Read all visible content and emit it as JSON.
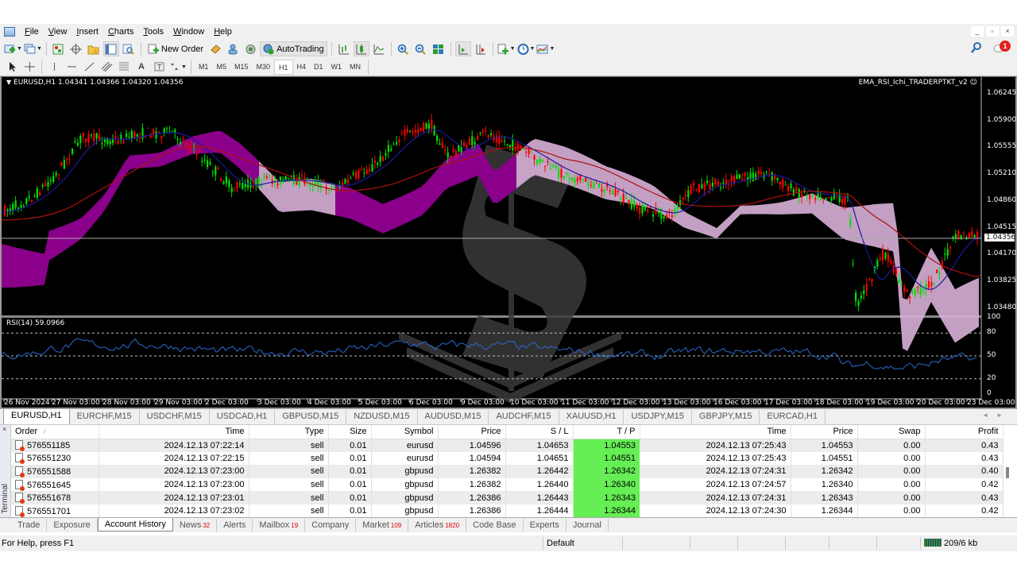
{
  "menu": {
    "items": [
      {
        "label": "File",
        "accel": "F"
      },
      {
        "label": "View",
        "accel": "V"
      },
      {
        "label": "Insert",
        "accel": "I"
      },
      {
        "label": "Charts",
        "accel": "C"
      },
      {
        "label": "Tools",
        "accel": "T"
      },
      {
        "label": "Window",
        "accel": "W"
      },
      {
        "label": "Help",
        "accel": "H"
      }
    ],
    "window_buttons": [
      "_",
      "▫",
      "×"
    ]
  },
  "toolbar": {
    "new_order_label": "New Order",
    "autotrading_label": "AutoTrading",
    "notification_count": "1"
  },
  "timeframes": [
    "M1",
    "M5",
    "M15",
    "M30",
    "H1",
    "H4",
    "D1",
    "W1",
    "MN"
  ],
  "active_timeframe": "H1",
  "chart": {
    "header": "EURUSD,H1  1.04341 1.04366 1.04320 1.04356",
    "symbol": "EURUSD,H1",
    "ohlc": {
      "open": "1.04341",
      "high": "1.04366",
      "low": "1.04320",
      "close": "1.04356"
    },
    "expert_label": "EMA_RSI_Ichi_TRADERPTKT_v2 ☺",
    "current_price": "1.04356",
    "price_ticks": [
      "1.06245",
      "1.05900",
      "1.05555",
      "1.05210",
      "1.04860",
      "1.04515",
      "1.04170",
      "1.03825",
      "1.03480"
    ],
    "rsi_label": "RSI(14) 59.0966",
    "rsi_ticks": [
      "100",
      "80",
      "50",
      "20",
      "0"
    ],
    "time_ticks": [
      "26 Nov 2024",
      "27 Nov 03:00",
      "28 Nov 03:00",
      "29 Nov 03:00",
      "2 Dec 03:00",
      "3 Dec 03:00",
      "4 Dec 03:00",
      "5 Dec 03:00",
      "6 Dec 03:00",
      "9 Dec 03:00",
      "10 Dec 03:00",
      "11 Dec 03:00",
      "12 Dec 03:00",
      "13 Dec 03:00",
      "16 Dec 03:00",
      "17 Dec 03:00",
      "18 Dec 03:00",
      "19 Dec 03:00",
      "20 Dec 03:00",
      "23 Dec 03:00"
    ],
    "colors": {
      "bull": "#00e000",
      "bear": "#ff0000",
      "cloud_bull": "#8b008b",
      "cloud_bear": "#d8b0d8",
      "ema_fast": "#1a1aa0",
      "ema_slow": "#b01010",
      "rsi": "#2a6ad0"
    }
  },
  "chart_tabs": [
    "EURUSD,H1",
    "EURCHF,M15",
    "USDCHF,M15",
    "USDCAD,H1",
    "GBPUSD,M15",
    "NZDUSD,M15",
    "AUDUSD,M15",
    "AUDCHF,M15",
    "XAUUSD,H1",
    "USDJPY,M15",
    "GBPJPY,M15",
    "EURCAD,H1"
  ],
  "active_chart_tab": "EURUSD,H1",
  "history": {
    "columns": [
      "Order",
      "Time",
      "Type",
      "Size",
      "Symbol",
      "Price",
      "S / L",
      "T / P",
      "Time",
      "Price",
      "Swap",
      "Profit"
    ],
    "sort_indicator": "/",
    "rows": [
      [
        "576551185",
        "2024.12.13 07:22:14",
        "sell",
        "0.01",
        "eurusd",
        "1.04596",
        "1.04653",
        "1.04553",
        "2024.12.13 07:25:43",
        "1.04553",
        "0.00",
        "0.43"
      ],
      [
        "576551230",
        "2024.12.13 07:22:15",
        "sell",
        "0.01",
        "eurusd",
        "1.04594",
        "1.04651",
        "1.04551",
        "2024.12.13 07:25:43",
        "1.04551",
        "0.00",
        "0.43"
      ],
      [
        "576551588",
        "2024.12.13 07:23:00",
        "sell",
        "0.01",
        "gbpusd",
        "1.26382",
        "1.26442",
        "1.26342",
        "2024.12.13 07:24:31",
        "1.26342",
        "0.00",
        "0.40"
      ],
      [
        "576551645",
        "2024.12.13 07:23:00",
        "sell",
        "0.01",
        "gbpusd",
        "1.26382",
        "1.26440",
        "1.26340",
        "2024.12.13 07:24:57",
        "1.26340",
        "0.00",
        "0.42"
      ],
      [
        "576551678",
        "2024.12.13 07:23:01",
        "sell",
        "0.01",
        "gbpusd",
        "1.26386",
        "1.26443",
        "1.26343",
        "2024.12.13 07:24:31",
        "1.26343",
        "0.00",
        "0.43"
      ],
      [
        "576551701",
        "2024.12.13 07:23:02",
        "sell",
        "0.01",
        "gbpusd",
        "1.26386",
        "1.26444",
        "1.26344",
        "2024.12.13 07:24:30",
        "1.26344",
        "0.00",
        "0.42"
      ]
    ]
  },
  "terminal": {
    "side_label": "Terminal",
    "close_glyph": "×",
    "tabs": [
      {
        "label": "Trade",
        "count": ""
      },
      {
        "label": "Exposure",
        "count": ""
      },
      {
        "label": "Account History",
        "count": ""
      },
      {
        "label": "News",
        "count": "32"
      },
      {
        "label": "Alerts",
        "count": ""
      },
      {
        "label": "Mailbox",
        "count": "19"
      },
      {
        "label": "Company",
        "count": ""
      },
      {
        "label": "Market",
        "count": "109"
      },
      {
        "label": "Articles",
        "count": "1820"
      },
      {
        "label": "Code Base",
        "count": ""
      },
      {
        "label": "Experts",
        "count": ""
      },
      {
        "label": "Journal",
        "count": ""
      }
    ],
    "active_tab": "Account History"
  },
  "status": {
    "help": "For Help, press F1",
    "profile": "Default",
    "traffic": "209/6 kb"
  }
}
